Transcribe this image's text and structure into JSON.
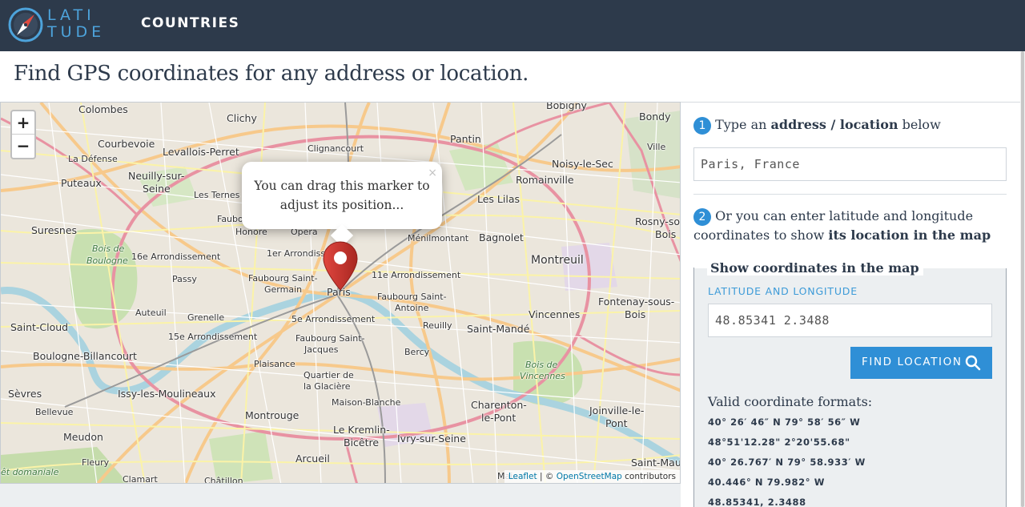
{
  "header": {
    "logo_line1": "LATI",
    "logo_line2": "TUDE",
    "nav_countries": "COUNTRIES"
  },
  "page": {
    "title": "Find GPS coordinates for any address or location."
  },
  "map": {
    "zoom_in": "+",
    "zoom_out": "−",
    "popup_text": "You can drag this marker to adjust its position...",
    "popup_close": "×",
    "attribution_leaflet": "Leaflet",
    "attribution_sep": " | © ",
    "attribution_osm": "OpenStreetMap",
    "attribution_suffix": " contributors",
    "labels": {
      "colombes": "Colombes",
      "clichy": "Clichy",
      "bobigny": "Bobigny",
      "bondy": "Bondy",
      "courbevoie": "Courbevoie",
      "levallois": "Levallois-Perret",
      "clignancourt": "Clignancourt",
      "pantin": "Pantin",
      "ladefense": "La Défense",
      "neuilly1": "Neuilly-sur-",
      "neuilly2": "Seine",
      "puteaux": "Puteaux",
      "lesternes": "Les Ternes",
      "noisy": "Noisy-le-Sec",
      "romainville": "Romainville",
      "leslilas": "Les Lilas",
      "villemomble": "Ville",
      "rosny1": "Rosny-so",
      "rosny2": "Bois",
      "suresnes": "Suresnes",
      "faubo": "Faubo",
      "honore": "Honore",
      "opera": "Opera",
      "menilmontant": "Ménilmontant",
      "bagnolet": "Bagnolet",
      "boisboulogne1": "Bois de",
      "boisboulogne2": "Boulogne",
      "arr16": "16e Arrondissement",
      "arr1": "1er Arrondisse",
      "montreuil": "Montreuil",
      "passy": "Passy",
      "fbgstgermain1": "Faubourg Saint-",
      "fbgstgermain2": "Germain",
      "arr11": "11e Arrondissement",
      "paris": "Paris",
      "fbgstantoine1": "Faubourg Saint-",
      "fbgstantoine2": "Antoine",
      "auteuil": "Auteuil",
      "grenelle": "Grenelle",
      "vincennes": "Vincennes",
      "fontenay1": "Fontenay-sous-",
      "fontenay2": "Bois",
      "arr5": "5e Arrondissement",
      "saintcloud": "Saint-Cloud",
      "reuilly": "Reuilly",
      "saintmande": "Saint-Mandé",
      "arr15": "15e Arrondissement",
      "fbgstjacques1": "Faubourg Saint-",
      "fbgstjacques2": "Jacques",
      "boulogne": "Boulogne-Billancourt",
      "bercy": "Bercy",
      "boisvincennes1": "Bois de",
      "boisvincennes2": "Vincennes",
      "plaisance": "Plaisance",
      "glaciere1": "Quartier de",
      "glaciere2": "la Glacière",
      "sevres": "Sèvres",
      "issy": "Issy-les-Moulineaux",
      "maisonblanche": "Maison-Blanche",
      "charenton1": "Charenton-",
      "charenton2": "le-Pont",
      "joinville1": "Joinville-le-",
      "joinville2": "Pont",
      "bellevue": "Bellevue",
      "montrouge": "Montrouge",
      "kremlin1": "Le Kremlin-",
      "kremlin2": "Bicêtre",
      "ivry": "Ivry-sur-Seine",
      "meudon": "Meudon",
      "arcueil": "Arcueil",
      "saintmaur": "Saint-Mau",
      "fleury": "Fleury",
      "domaniale": "êt domaniale",
      "clamart": "Clamart",
      "chatillon": "Châtillon",
      "maisons": "Mais"
    }
  },
  "panel": {
    "step1_number": "1",
    "step1_pre": "Type an ",
    "step1_bold": "address / location",
    "step1_post": " below",
    "address_value": "Paris, France",
    "step2_number": "2",
    "step2_pre": "Or you can enter latitude and longitude coordinates to show ",
    "step2_bold": "its location in the map",
    "legend": "Show coordinates in the map",
    "coord_label": "LATITUDE AND LONGITUDE",
    "coord_value": "48.85341 2.3488",
    "find_button": "FIND LOCATION",
    "formats_title": "Valid coordinate formats:",
    "formats": [
      "40° 26′ 46″ N 79° 58′ 56″ W",
      "48°51'12.28\" 2°20'55.68\"",
      "40° 26.767′ N 79° 58.933′ W",
      "40.446° N 79.982° W",
      "48.85341, 2.3488"
    ]
  },
  "colors": {
    "header_bg": "#2d3a4b",
    "accent": "#2f8fd6",
    "marker": "#c9302c"
  },
  "icons": {
    "logo": "compass-icon",
    "search": "search-icon",
    "marker": "map-marker-icon"
  }
}
